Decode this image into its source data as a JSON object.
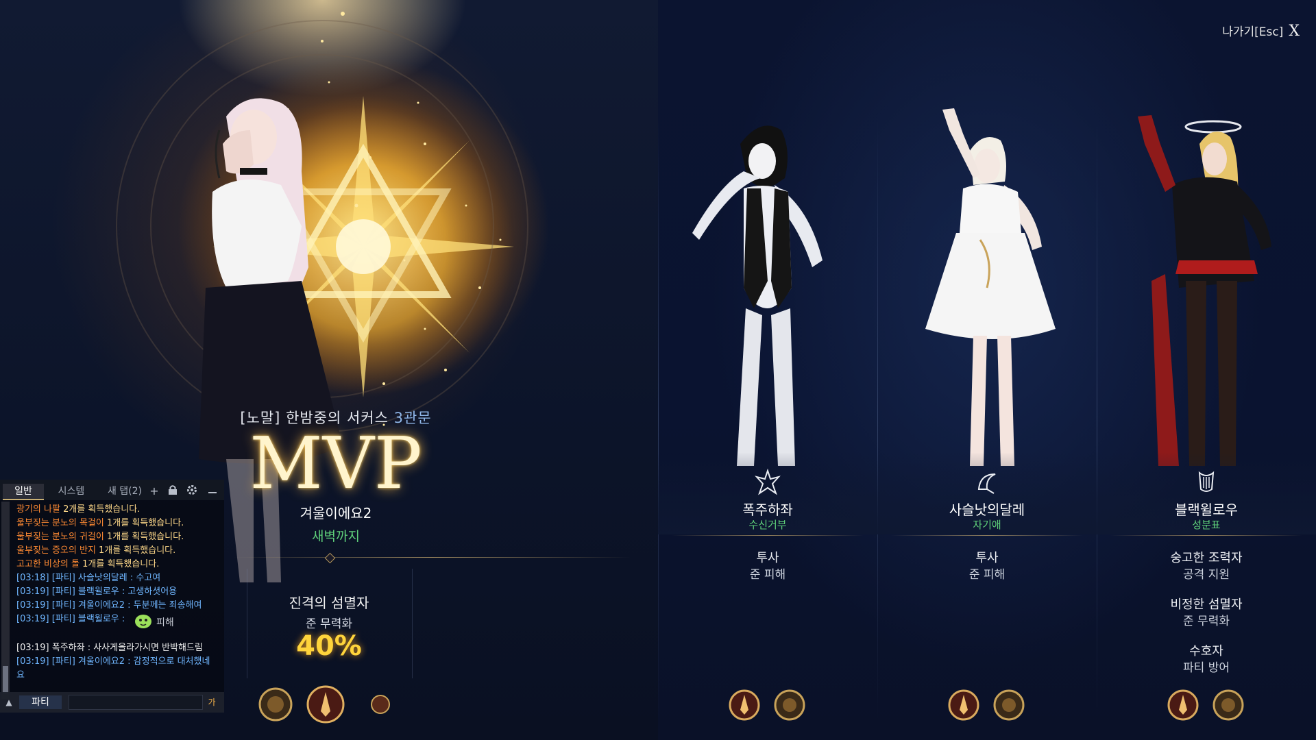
{
  "header": {
    "exit_label": "나가기[Esc]",
    "exit_icon": "X"
  },
  "mvp": {
    "dungeon_prefix": "[노말] 한밤중의 서커스",
    "dungeon_gate": "3관문",
    "title": "MVP",
    "player_name": "겨울이에요2",
    "player_guild": "새벽까지",
    "stat_title": "진격의 섬멸자",
    "stat_sub": "준 무력화",
    "stat_value": "40%"
  },
  "chat": {
    "tabs": [
      "일반",
      "시스템",
      "새 탭(2)"
    ],
    "add_icon": "+",
    "channel": "파티",
    "ime_label": "가",
    "overlay_text": "피해",
    "loot_lines": [
      {
        "item": "광기의 나팔",
        "rest": " 2개를 획득했습니다."
      },
      {
        "item": "울부짖는 분노의 목걸이",
        "rest": " 1개를 획득했습니다."
      },
      {
        "item": "울부짖는 분노의 귀걸이",
        "rest": " 1개를 획득했습니다."
      },
      {
        "item": "울부짖는 증오의 반지",
        "rest": " 1개를 획득했습니다."
      },
      {
        "item": "고고한 비상의 돌",
        "rest": " 1개를 획득했습니다."
      }
    ],
    "party_lines": [
      "[03:18] [파티] 사슬낫의달레 : 수고여",
      "[03:19] [파티] 블랙윌로우 : 고생하셧어용",
      "[03:19] [파티] 겨울이에요2 : 두분께는 죄송해여",
      "[03:19] [파티] 블랙윌로우 :"
    ],
    "last_lines": [
      "[03:19] 폭주하좌 : 사사게올라가시면 반박해드림",
      "[03:19] [파티] 겨울이에요2 : 감정적으로 대처했네",
      "요"
    ]
  },
  "party": [
    {
      "name": "폭주하좌",
      "guild": "수신거부",
      "class_icon": "berserker-class-icon",
      "stats": [
        {
          "title": "투사",
          "sub": "준 피해"
        }
      ]
    },
    {
      "name": "사슬낫의달레",
      "guild": "자기애",
      "class_icon": "reaper-class-icon",
      "stats": [
        {
          "title": "투사",
          "sub": "준 피해"
        }
      ]
    },
    {
      "name": "블랙윌로우",
      "guild": "성분표",
      "class_icon": "bard-class-icon",
      "stats": [
        {
          "title": "숭고한 조력자",
          "sub": "공격 지원"
        },
        {
          "title": "비정한 섬멸자",
          "sub": "준 무력화"
        },
        {
          "title": "수호자",
          "sub": "파티 방어"
        }
      ]
    }
  ],
  "colors": {
    "mvp_gold": "#ffd43b",
    "guild_green": "#5fd07a",
    "gate_blue": "#8fb6e8",
    "loot_orange": "#ff8a33",
    "party_blue": "#6fb6ff"
  }
}
